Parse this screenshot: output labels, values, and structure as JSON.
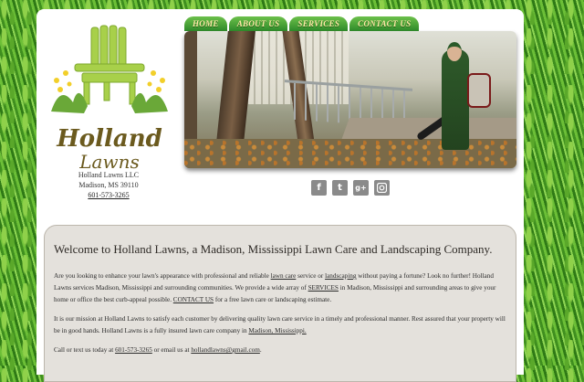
{
  "nav": {
    "tabs": [
      "HOME",
      "ABOUT US",
      "SERVICES",
      "CONTACT US"
    ]
  },
  "logo": {
    "line1": "Holland",
    "line2": "Lawns"
  },
  "address": {
    "company": "Holland Lawns LLC",
    "city": "Madison, MS 39110",
    "phone": "601-573-3265"
  },
  "social": {
    "icons": [
      "facebook-icon",
      "twitter-icon",
      "google-plus-icon",
      "instagram-icon"
    ]
  },
  "content": {
    "heading": "Welcome to Holland Lawns, a Madison, Mississippi Lawn Care and Landscaping Company.",
    "p1_a": "Are you looking to enhance your lawn's appearance with professional and reliable",
    "p1_link1": "lawn care",
    "p1_b": "service or",
    "p1_link2": "landscaping",
    "p1_c": "without paying a fortune? Look no further! Holland Lawns services Madison, Mississippi and surrounding communities. We provide a wide array of",
    "p1_link3": "SERVICES",
    "p1_d": "in Madison, Mississippi and surrounding areas to give your home or office the best curb-appeal possible.",
    "p1_link4": "CONTACT US",
    "p1_e": "for a free lawn care or landscaping estimate.",
    "p2_a": "It is our mission at Holland Lawns to satisfy each customer by delivering quality lawn care service in a timely and professional manner. Rest assured that your property will be in good hands. Holland Lawns is a fully insured lawn care company in",
    "p2_link": "Madison, Mississippi.",
    "p3_a": "Call or text us today at",
    "p3_phone": "601-573-3265",
    "p3_b": "or email us at",
    "p3_email": "hollandlawns@gmail.com",
    "p3_c": "."
  }
}
